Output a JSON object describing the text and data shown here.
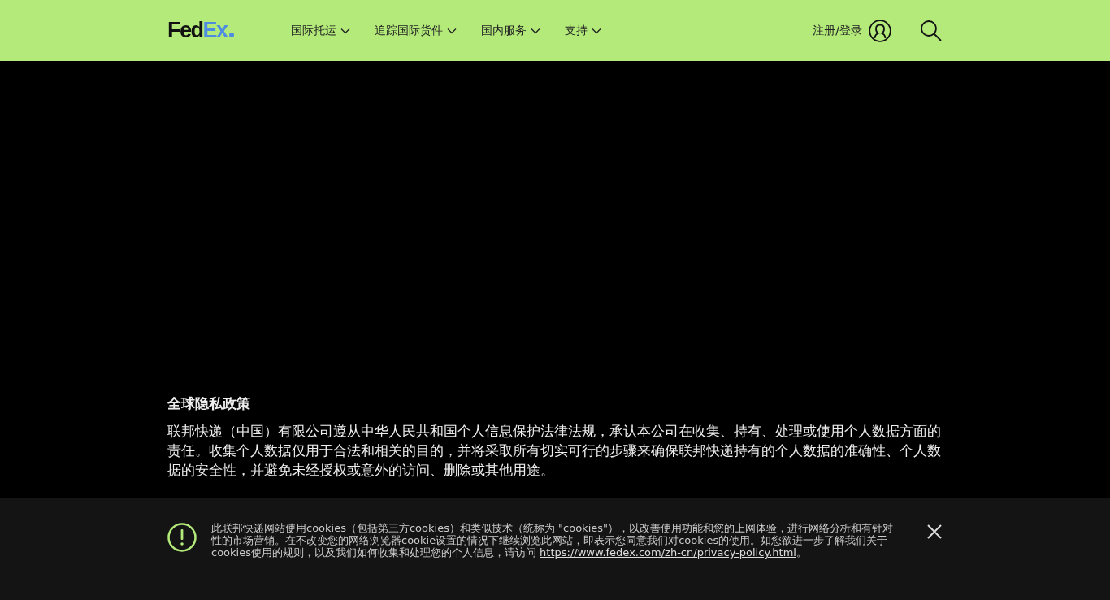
{
  "header": {
    "logo": {
      "part_1": "Fed",
      "part_2": "Ex"
    },
    "nav": [
      {
        "label": "国际托运"
      },
      {
        "label": "追踪国际货件"
      },
      {
        "label": "国内服务"
      },
      {
        "label": "支持"
      }
    ],
    "account": {
      "label": "注册/登录"
    }
  },
  "content": {
    "heading": "全球隐私政策",
    "paragraph": "联邦快递（中国）有限公司遵从中华人民共和国个人信息保护法律法规，承认本公司在收集、持有、处理或使用个人数据方面的责任。收集个人数据仅用于合法和相关的目的，并将采取所有切实可行的步骤来确保联邦快递持有的个人数据的准确性、个人数据的安全性，并避免未经授权或意外的访问、删除或其他用途。"
  },
  "cookie_banner": {
    "text": "此联邦快递网站使用cookies（包括第三方cookies）和类似技术（统称为 \"cookies\"），以改善使用功能和您的上网体验，进行网络分析和有针对性的市场营销。在不改变您的网络浏览器cookie设置的情况下继续浏览此网站，即表示您同意我们对cookies的使用。如您欲进一步了解我们关于cookies使用的规则，以及我们如何收集和处理您的个人信息，请访问 ",
    "link": "https://www.fedex.com/zh-cn/privacy-policy.html",
    "suffix": "。"
  }
}
